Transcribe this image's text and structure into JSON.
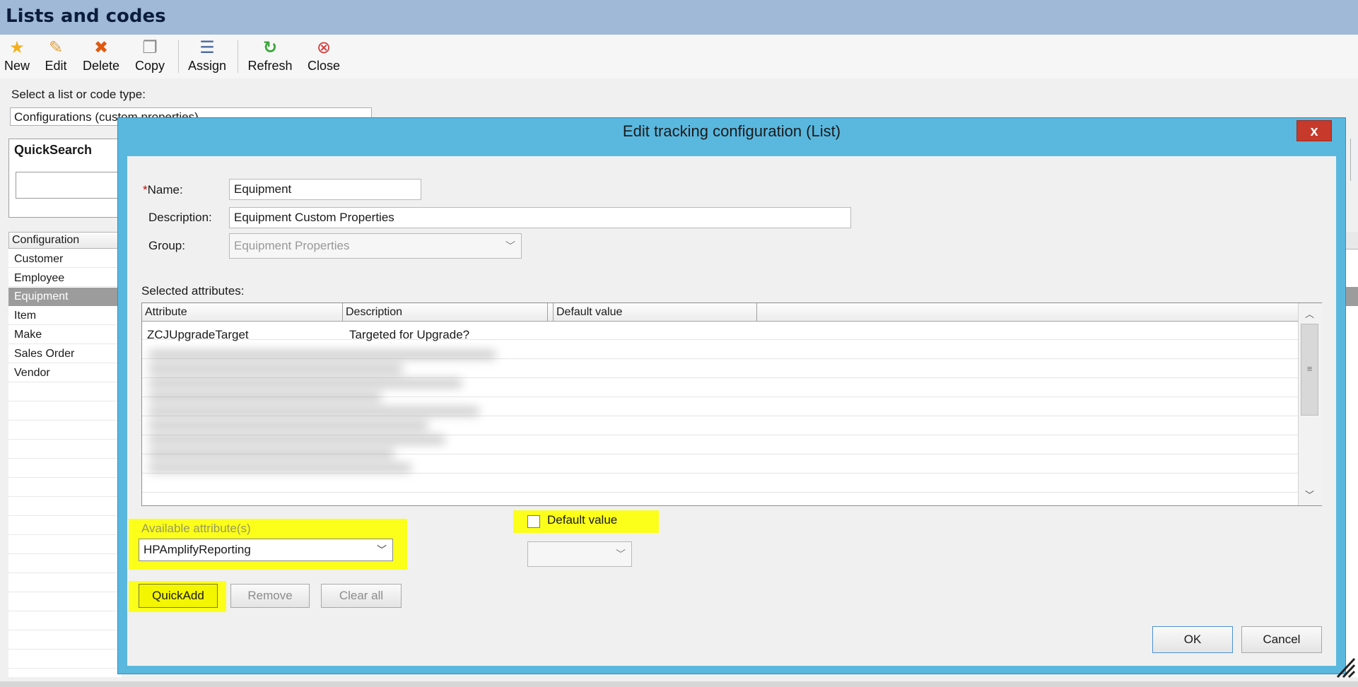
{
  "window": {
    "title": "Lists and codes"
  },
  "toolbar": {
    "new": "New",
    "edit": "Edit",
    "delete": "Delete",
    "copy": "Copy",
    "assign": "Assign",
    "refresh": "Refresh",
    "close": "Close",
    "icons": [
      "star-icon",
      "pencil-icon",
      "delete-x-icon",
      "copy-icon",
      "assign-icon",
      "refresh-icon",
      "close-circle-icon"
    ]
  },
  "list_type": {
    "label": "Select a list or code type:",
    "value": "Configurations (custom properties)"
  },
  "quicksearch": {
    "title": "QuickSearch",
    "value": ""
  },
  "config_list": {
    "header": "Configuration",
    "items": [
      "Customer",
      "Employee",
      "Equipment",
      "Item",
      "Make",
      "Sales Order",
      "Vendor"
    ],
    "selected_index": 2
  },
  "dialog": {
    "title": "Edit tracking configuration (List)",
    "close_label": "x",
    "name_label": "Name:",
    "required_mark": "*",
    "name_value": "Equipment",
    "description_label": "Description:",
    "description_value": "Equipment Custom Properties",
    "group_label": "Group:",
    "group_value": "Equipment Properties",
    "selected_attributes_label": "Selected attributes:",
    "grid": {
      "columns": [
        "Attribute",
        "Description",
        "Default value"
      ],
      "rows": [
        {
          "attribute": "ZCJUpgradeTarget",
          "description": "Targeted for Upgrade?"
        }
      ]
    },
    "available_label": "Available attribute(s)",
    "available_value": "HPAmplifyReporting",
    "default_value_label": "Default value",
    "default_value_checked": false,
    "default_value_select": "",
    "quickadd": "QuickAdd",
    "remove": "Remove",
    "clear_all": "Clear all",
    "ok": "OK",
    "cancel": "Cancel"
  },
  "colors": {
    "highlight": "#fbff1a",
    "dialog_frame": "#5ab8df",
    "title_bar": "#9fb9d6",
    "close_red": "#c7392b"
  }
}
